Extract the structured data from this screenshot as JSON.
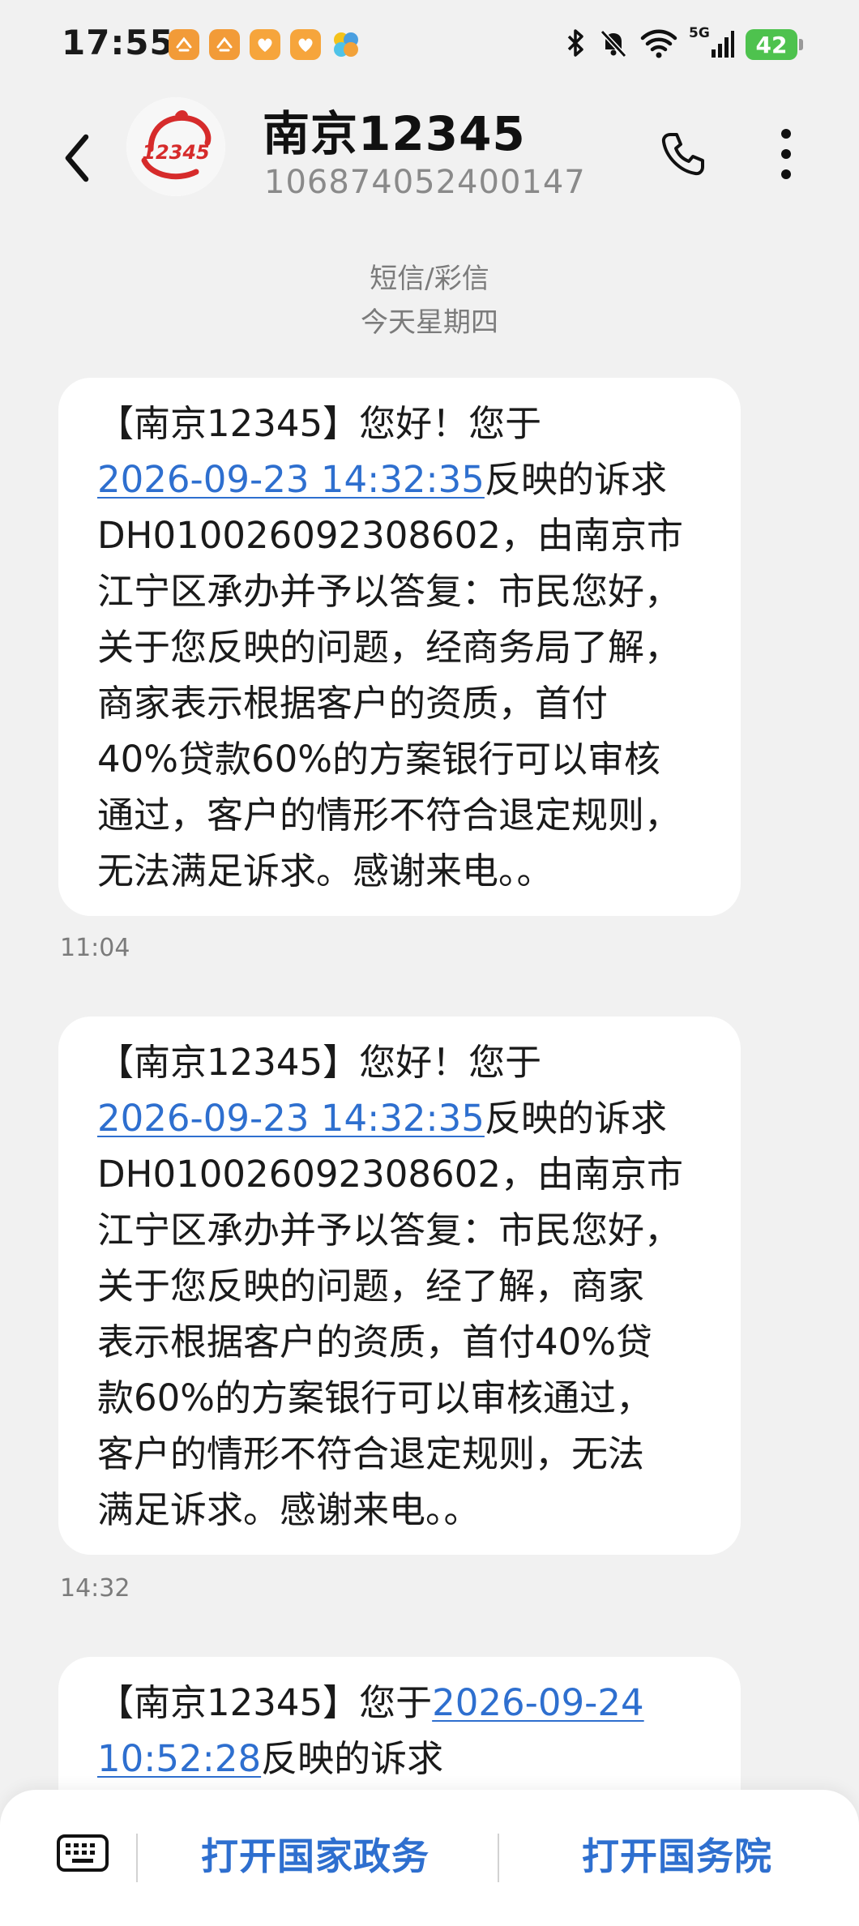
{
  "status_bar": {
    "time": "17:55",
    "network": "5G",
    "battery": "42"
  },
  "header": {
    "contact_name": "南京12345",
    "contact_number": "106874052400147",
    "avatar_text": "12345"
  },
  "thread": {
    "channel_label": "短信/彩信",
    "date_label": "今天星期四"
  },
  "messages": [
    {
      "lines": [
        {
          "text": "【南京12345】您好！您于"
        },
        {
          "link": "2026-09-23 14:32:35",
          "text": "反映的诉求"
        },
        {
          "text": "DH010026092308602，由南京市"
        },
        {
          "text": "江宁区承办并予以答复：市民您好，"
        },
        {
          "text": "关于您反映的问题，经商务局了解，"
        },
        {
          "text": "商家表示根据客户的资质，首付"
        },
        {
          "text": "40%贷款60%的方案银行可以审核"
        },
        {
          "text": "通过，客户的情形不符合退定规则，"
        },
        {
          "text": "无法满足诉求。感谢来电。。"
        }
      ],
      "time": "11:04"
    },
    {
      "lines": [
        {
          "text": "【南京12345】您好！您于"
        },
        {
          "link": "2026-09-23 14:32:35",
          "text": "反映的诉求"
        },
        {
          "text": "DH010026092308602，由南京市"
        },
        {
          "text": "江宁区承办并予以答复：市民您好，"
        },
        {
          "text": "关于您反映的问题，经了解，商家"
        },
        {
          "text": "表示根据客户的资质，首付40%贷"
        },
        {
          "text": "款60%的方案银行可以审核通过，"
        },
        {
          "text": "客户的情形不符合退定规则，无法"
        },
        {
          "text": "满足诉求。感谢来电。。"
        }
      ],
      "time": "14:32"
    },
    {
      "lines": [
        {
          "prefix": "【南京12345】您于",
          "link": "2026-09-24"
        },
        {
          "link": "10:52:28",
          "text": "反映的诉求"
        }
      ]
    }
  ],
  "bottom_bar": {
    "button_1": "打开国家政务",
    "button_2": "打开国务院"
  },
  "colors": {
    "link": "#2e6fcf",
    "background": "#f1f1f1",
    "bubble": "#ffffff",
    "battery": "#4ec24e",
    "avatar_red": "#d62b2b"
  }
}
